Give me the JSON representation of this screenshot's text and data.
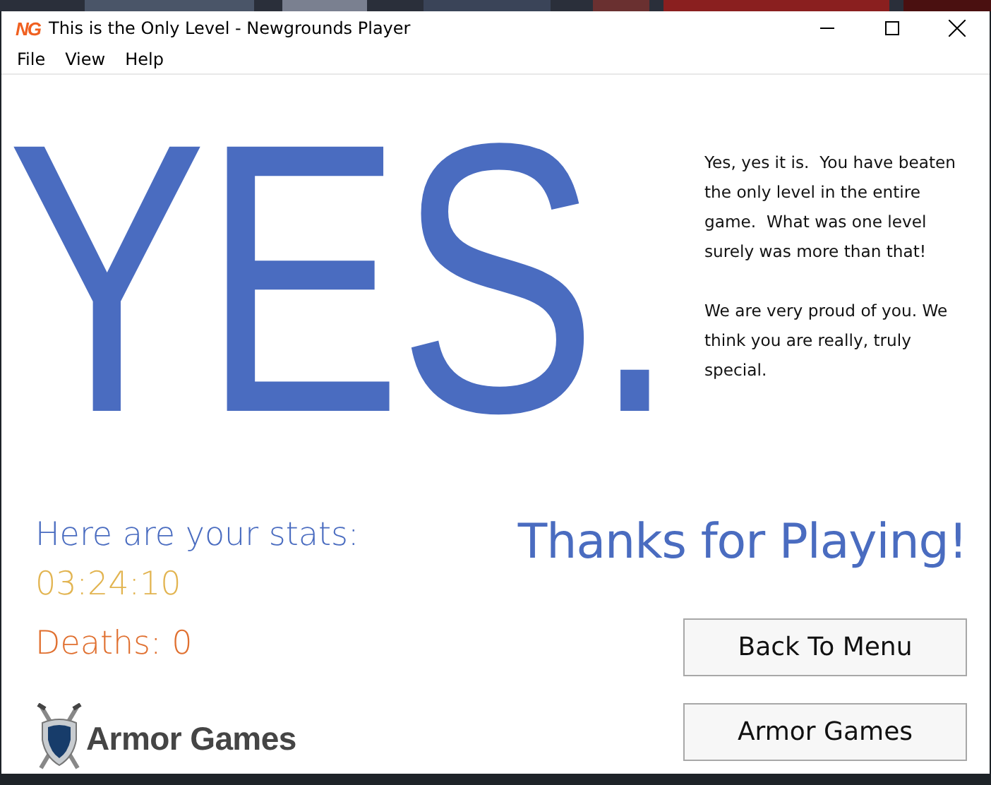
{
  "window": {
    "title": "This is the Only Level - Newgrounds Player",
    "app_icon": "NG"
  },
  "menu": [
    "File",
    "View",
    "Help"
  ],
  "headline": "YES.",
  "message": [
    "Yes, yes it is.  You have beaten the only level in the entire game.  What was one level surely was more than that!",
    "We are very proud of you. We think you are really, truly special."
  ],
  "stats": {
    "heading": "Here are your stats:",
    "time": "03:24:10",
    "deaths": "Deaths: 0"
  },
  "thanks": "Thanks for Playing!",
  "logo": {
    "text": "Armor Games"
  },
  "buttons": [
    "Back To Menu",
    "Armor Games"
  ]
}
